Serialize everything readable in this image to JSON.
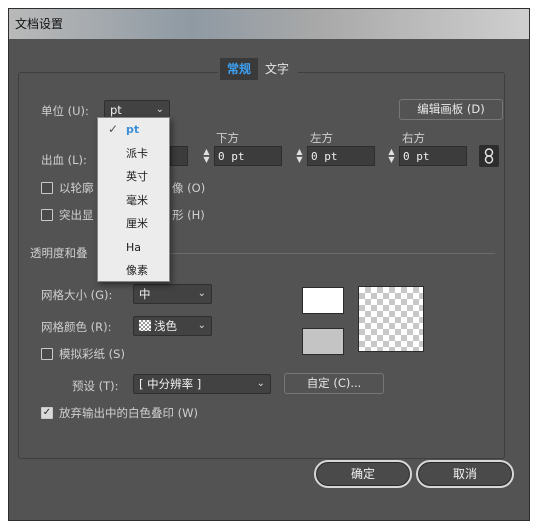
{
  "window": {
    "title": "文档设置"
  },
  "tabs": [
    {
      "label": "常规",
      "active": true
    },
    {
      "label": "文字",
      "active": false
    }
  ],
  "unit": {
    "label": "单位 (U):",
    "value": "pt",
    "options": [
      "pt",
      "派卡",
      "英寸",
      "毫米",
      "厘米",
      "Ha",
      "像素"
    ]
  },
  "edit_artboard_button": "编辑画板 (D)",
  "bleed": {
    "label": "出血 (L):",
    "columns": [
      "下方",
      "左方",
      "右方"
    ],
    "values": [
      "0 pt",
      "0 pt",
      "0 pt"
    ]
  },
  "outline": {
    "label_left": "以轮廓",
    "label_right": "像 (O)",
    "checked": false
  },
  "highlight": {
    "label_left": "突出显",
    "label_right": "形 (H)",
    "checked": false
  },
  "transparency": {
    "section_label": "透明度和叠",
    "grid_size_label": "网格大小 (G):",
    "grid_size_value": "中",
    "grid_color_label": "网格颜色 (R):",
    "grid_color_value": "浅色",
    "simulate_paper": {
      "label": "模拟彩纸 (S)",
      "checked": false
    },
    "preset_label": "预设 (T):",
    "preset_value": "[ 中分辨率 ]",
    "custom_button": "自定 (C)...",
    "discard_white": {
      "label": "放弃输出中的白色叠印 (W)",
      "checked": true
    },
    "swatch_colors": [
      "#ffffff",
      "#c4c4c4"
    ]
  },
  "footer": {
    "ok": "确定",
    "cancel": "取消"
  },
  "colors": {
    "accent": "#3da0f2",
    "panel": "#535353"
  }
}
